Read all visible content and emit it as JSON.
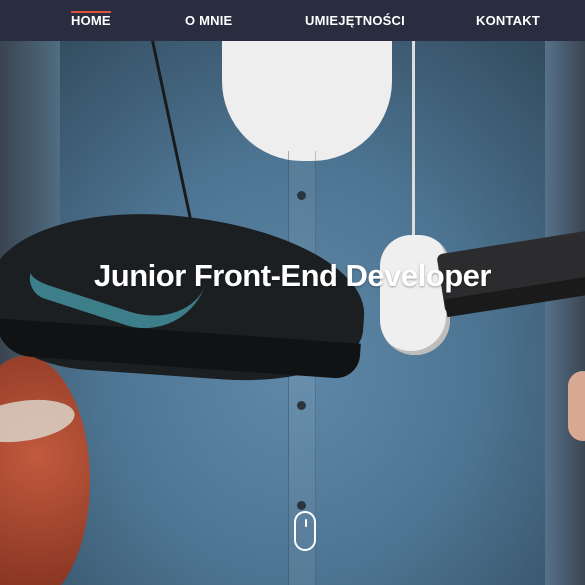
{
  "nav": {
    "items": [
      {
        "label": "HOME",
        "active": true
      },
      {
        "label": "O MNIE",
        "active": false
      },
      {
        "label": "UMIEJĘTNOŚCI",
        "active": false
      },
      {
        "label": "KONTAKT",
        "active": false
      }
    ]
  },
  "hero": {
    "headline": "Junior Front-End Developer",
    "scroll_icon": "mouse-scroll-icon"
  },
  "colors": {
    "nav_background": "#2a2d40",
    "nav_text": "#ffffff",
    "active_indicator": "#e0523c",
    "headline": "#ffffff"
  }
}
